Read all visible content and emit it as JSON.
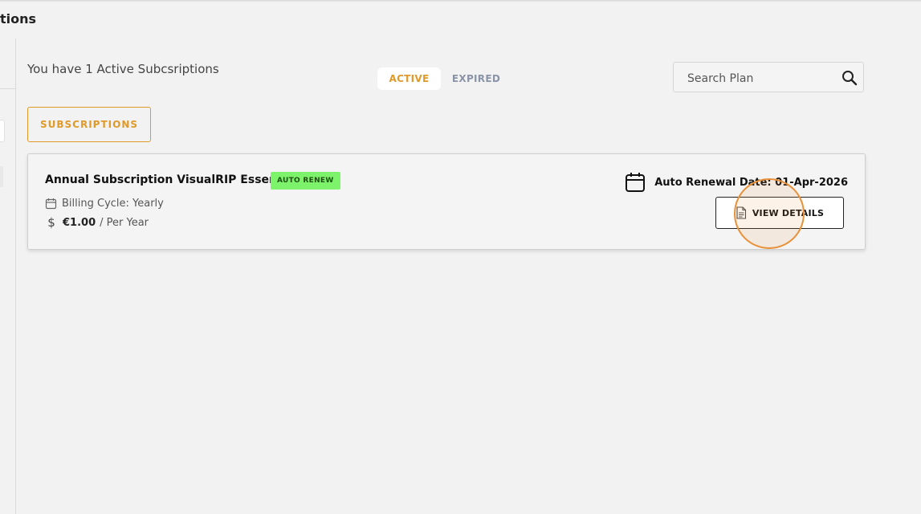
{
  "header": {
    "title": "tions"
  },
  "summary": {
    "text": "You have 1 Active Subcsriptions"
  },
  "tabs": [
    {
      "label": "ACTIVE",
      "active": true
    },
    {
      "label": "EXPIRED",
      "active": false
    }
  ],
  "search": {
    "placeholder": "Search Plan",
    "value": "",
    "icon": "search-icon"
  },
  "subscriptions_button": {
    "label": "SUBSCRIPTIONS"
  },
  "subscription_card": {
    "plan_name": "Annual Subscription VisualRIP Essentials",
    "badge": "AUTO RENEW",
    "billing_cycle": "Billing Cycle: Yearly",
    "price": "€1.00",
    "price_period": "/ Per Year",
    "renewal": "Auto Renewal Date: 01-Apr-2026",
    "view_details_label": "VIEW DETAILS"
  },
  "colors": {
    "accent": "#e09a2a",
    "badge_bg": "#7cf36a",
    "highlight_ring": "#e8913a",
    "background": "#f2f2f2"
  }
}
